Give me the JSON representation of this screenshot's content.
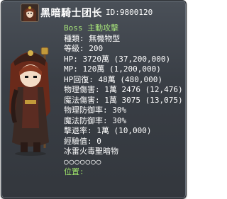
{
  "header": {
    "title": "黑暗騎士团长",
    "id_text": "ID:9800120"
  },
  "stats": {
    "tag": "Boss 主動攻擊",
    "type": "種類: 無機物型",
    "level": "等級: 200",
    "hp": "HP: 3720萬 (37,200,000)",
    "mp": "MP: 120萬 (1,200,000)",
    "hp_recovery": "HP回復: 48萬 (480,000)",
    "phys_damage": "物理傷害: 1萬 2476 (12,476)",
    "magic_damage": "魔法傷害: 1萬 3075 (13,075)",
    "phys_def": "物理防御率: 30%",
    "magic_def": "魔法防御率: 30%",
    "knockback": "擊退率: 1萬 (10,000)",
    "exp": "經驗值: 0",
    "elements_label": "冰雷火毒聖暗物",
    "elements_marks": "○○○○○○○",
    "location": "位置:"
  },
  "colors": {
    "panel": "#3a3f46",
    "highlight": "#9ee26a",
    "text": "#ffffff"
  },
  "icons": {
    "header": "monster-portrait-icon",
    "mob": "dark-knight-captain-sprite"
  }
}
